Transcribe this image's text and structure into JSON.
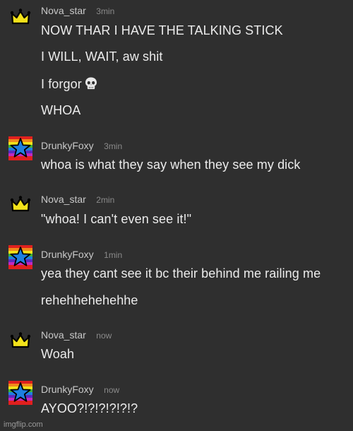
{
  "messages": [
    {
      "user": "Nova_star",
      "time": "3min",
      "avatar": "crown-icon",
      "lines": [
        "NOW THAR I HAVE THE TALKING STICK",
        "I WILL, WAIT, aw shit",
        "I forgor",
        "WHOA"
      ]
    },
    {
      "user": "DrunkyFoxy",
      "time": "3min",
      "avatar": "rainbow-star-icon",
      "lines": [
        "whoa is what they say when they see my dick"
      ]
    },
    {
      "user": "Nova_star",
      "time": "2min",
      "avatar": "crown-icon",
      "lines": [
        "\"whoa! I can't even see it!\""
      ]
    },
    {
      "user": "DrunkyFoxy",
      "time": "1min",
      "avatar": "rainbow-star-icon",
      "lines": [
        "yea they cant see it bc their behind me railing me",
        "rehehhehehehhe"
      ]
    },
    {
      "user": "Nova_star",
      "time": "now",
      "avatar": "crown-icon",
      "lines": [
        "Woah"
      ]
    },
    {
      "user": "DrunkyFoxy",
      "time": "now",
      "avatar": "rainbow-star-icon",
      "lines": [
        "AYOO?!?!?!?!?!?"
      ]
    }
  ],
  "skull_emoji": "skull-icon",
  "watermark": "imgflip.com",
  "colors": {
    "background": "#2f2f2f",
    "crown": "#f2e21a",
    "star": "#1e7fe0"
  }
}
